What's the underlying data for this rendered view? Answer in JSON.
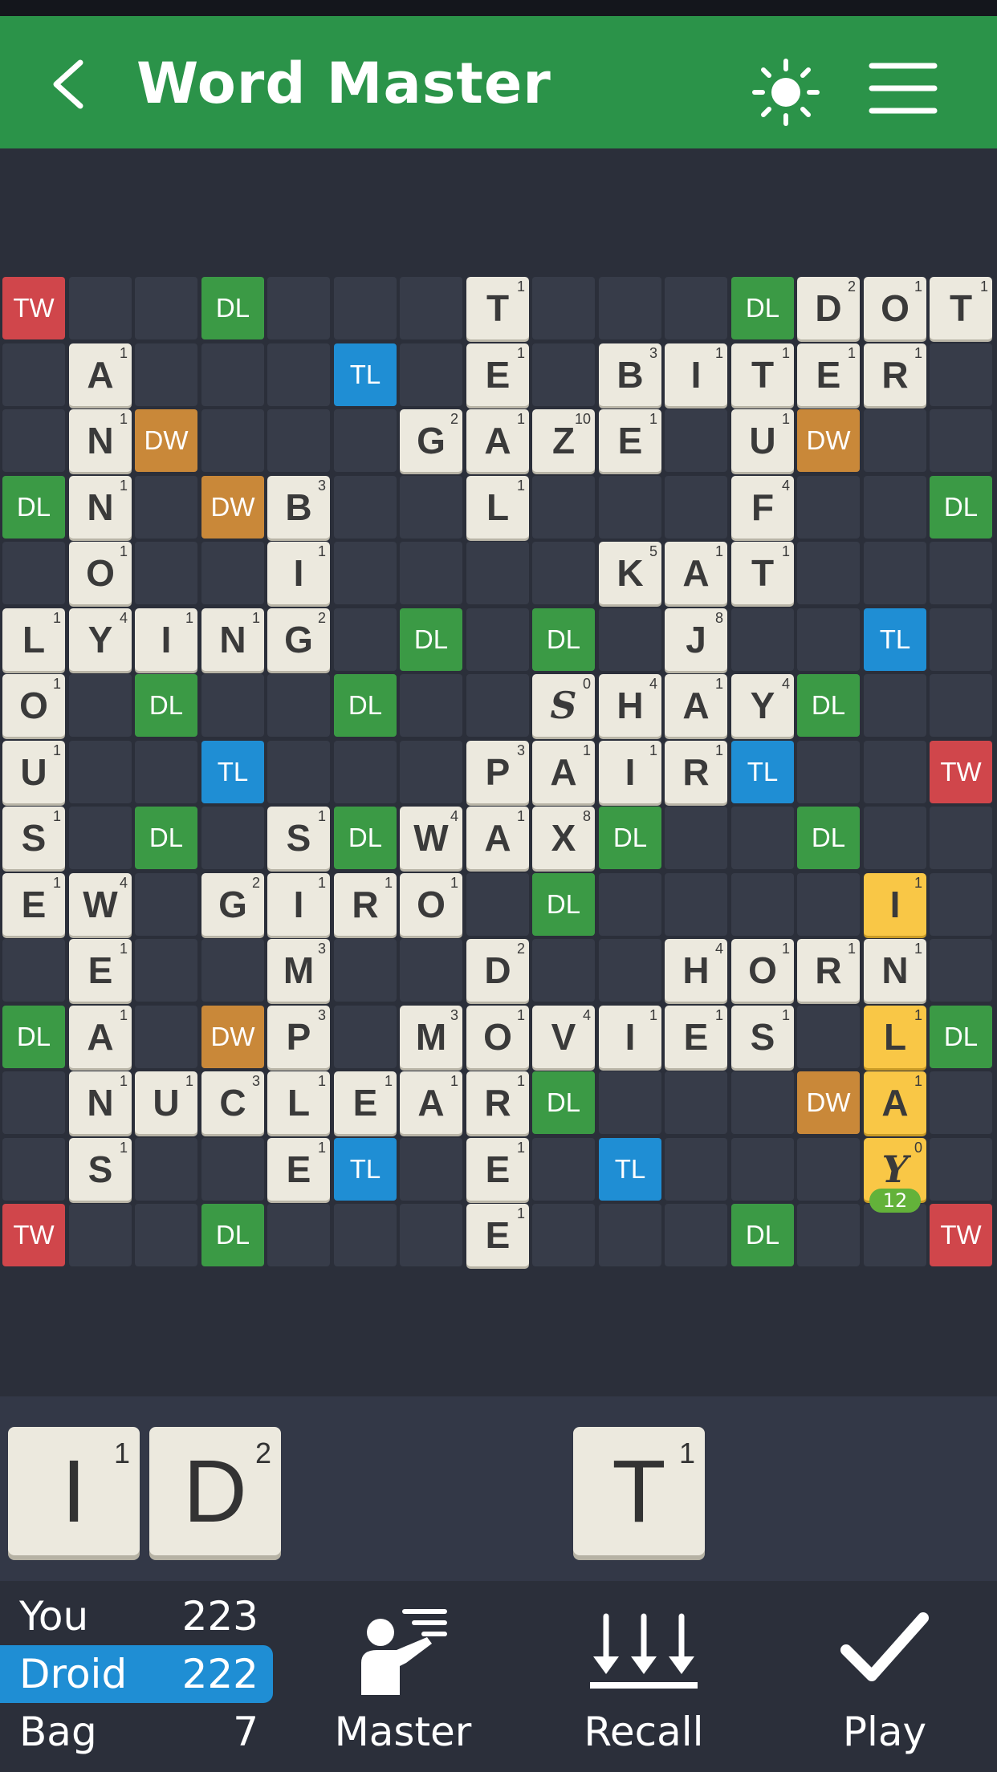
{
  "header": {
    "title": "Word Master",
    "back_icon": "chevron-left-icon",
    "theme_icon": "sun-icon",
    "menu_icon": "hamburger-menu-icon"
  },
  "colors": {
    "header": "#2b9349",
    "TW": "#d0464b",
    "DW": "#c98839",
    "TL": "#1f8ed4",
    "DL": "#3b9a45",
    "tile": "#ece9de",
    "recent_tile": "#f9c746",
    "active_score": "#1f8ed4"
  },
  "board": {
    "size": 15,
    "premiums": [
      {
        "r": 0,
        "c": 0,
        "type": "TW"
      },
      {
        "r": 0,
        "c": 3,
        "type": "DL"
      },
      {
        "r": 0,
        "c": 11,
        "type": "DL"
      },
      {
        "r": 1,
        "c": 5,
        "type": "TL"
      },
      {
        "r": 2,
        "c": 2,
        "type": "DW"
      },
      {
        "r": 2,
        "c": 12,
        "type": "DW"
      },
      {
        "r": 3,
        "c": 0,
        "type": "DL"
      },
      {
        "r": 3,
        "c": 3,
        "type": "DW"
      },
      {
        "r": 3,
        "c": 14,
        "type": "DL"
      },
      {
        "r": 5,
        "c": 6,
        "type": "DL"
      },
      {
        "r": 5,
        "c": 8,
        "type": "DL"
      },
      {
        "r": 5,
        "c": 13,
        "type": "TL"
      },
      {
        "r": 6,
        "c": 2,
        "type": "DL"
      },
      {
        "r": 6,
        "c": 5,
        "type": "DL"
      },
      {
        "r": 6,
        "c": 12,
        "type": "DL"
      },
      {
        "r": 7,
        "c": 3,
        "type": "TL"
      },
      {
        "r": 7,
        "c": 11,
        "type": "TL"
      },
      {
        "r": 7,
        "c": 14,
        "type": "TW"
      },
      {
        "r": 8,
        "c": 2,
        "type": "DL"
      },
      {
        "r": 8,
        "c": 5,
        "type": "DL"
      },
      {
        "r": 8,
        "c": 9,
        "type": "DL"
      },
      {
        "r": 8,
        "c": 12,
        "type": "DL"
      },
      {
        "r": 9,
        "c": 8,
        "type": "DL"
      },
      {
        "r": 11,
        "c": 0,
        "type": "DL"
      },
      {
        "r": 11,
        "c": 3,
        "type": "DW"
      },
      {
        "r": 11,
        "c": 14,
        "type": "DL"
      },
      {
        "r": 12,
        "c": 8,
        "type": "DL"
      },
      {
        "r": 12,
        "c": 12,
        "type": "DW"
      },
      {
        "r": 13,
        "c": 5,
        "type": "TL"
      },
      {
        "r": 13,
        "c": 9,
        "type": "TL"
      },
      {
        "r": 14,
        "c": 0,
        "type": "TW"
      },
      {
        "r": 14,
        "c": 3,
        "type": "DL"
      },
      {
        "r": 14,
        "c": 11,
        "type": "DL"
      },
      {
        "r": 14,
        "c": 14,
        "type": "TW"
      }
    ],
    "tiles": [
      {
        "r": 0,
        "c": 7,
        "l": "T",
        "v": "1"
      },
      {
        "r": 0,
        "c": 12,
        "l": "D",
        "v": "2"
      },
      {
        "r": 0,
        "c": 13,
        "l": "O",
        "v": "1"
      },
      {
        "r": 0,
        "c": 14,
        "l": "T",
        "v": "1"
      },
      {
        "r": 1,
        "c": 1,
        "l": "A",
        "v": "1"
      },
      {
        "r": 1,
        "c": 7,
        "l": "E",
        "v": "1"
      },
      {
        "r": 1,
        "c": 9,
        "l": "B",
        "v": "3"
      },
      {
        "r": 1,
        "c": 10,
        "l": "I",
        "v": "1"
      },
      {
        "r": 1,
        "c": 11,
        "l": "T",
        "v": "1"
      },
      {
        "r": 1,
        "c": 12,
        "l": "E",
        "v": "1"
      },
      {
        "r": 1,
        "c": 13,
        "l": "R",
        "v": "1"
      },
      {
        "r": 2,
        "c": 1,
        "l": "N",
        "v": "1"
      },
      {
        "r": 2,
        "c": 6,
        "l": "G",
        "v": "2"
      },
      {
        "r": 2,
        "c": 7,
        "l": "A",
        "v": "1"
      },
      {
        "r": 2,
        "c": 8,
        "l": "Z",
        "v": "10"
      },
      {
        "r": 2,
        "c": 9,
        "l": "E",
        "v": "1"
      },
      {
        "r": 2,
        "c": 11,
        "l": "U",
        "v": "1"
      },
      {
        "r": 3,
        "c": 1,
        "l": "N",
        "v": "1"
      },
      {
        "r": 3,
        "c": 4,
        "l": "B",
        "v": "3"
      },
      {
        "r": 3,
        "c": 7,
        "l": "L",
        "v": "1"
      },
      {
        "r": 3,
        "c": 11,
        "l": "F",
        "v": "4"
      },
      {
        "r": 4,
        "c": 1,
        "l": "O",
        "v": "1"
      },
      {
        "r": 4,
        "c": 4,
        "l": "I",
        "v": "1"
      },
      {
        "r": 4,
        "c": 9,
        "l": "K",
        "v": "5"
      },
      {
        "r": 4,
        "c": 10,
        "l": "A",
        "v": "1"
      },
      {
        "r": 4,
        "c": 11,
        "l": "T",
        "v": "1"
      },
      {
        "r": 5,
        "c": 0,
        "l": "L",
        "v": "1"
      },
      {
        "r": 5,
        "c": 1,
        "l": "Y",
        "v": "4"
      },
      {
        "r": 5,
        "c": 2,
        "l": "I",
        "v": "1"
      },
      {
        "r": 5,
        "c": 3,
        "l": "N",
        "v": "1"
      },
      {
        "r": 5,
        "c": 4,
        "l": "G",
        "v": "2"
      },
      {
        "r": 5,
        "c": 10,
        "l": "J",
        "v": "8"
      },
      {
        "r": 6,
        "c": 0,
        "l": "O",
        "v": "1"
      },
      {
        "r": 6,
        "c": 8,
        "l": "S",
        "v": "0",
        "blank": true
      },
      {
        "r": 6,
        "c": 9,
        "l": "H",
        "v": "4"
      },
      {
        "r": 6,
        "c": 10,
        "l": "A",
        "v": "1"
      },
      {
        "r": 6,
        "c": 11,
        "l": "Y",
        "v": "4"
      },
      {
        "r": 7,
        "c": 0,
        "l": "U",
        "v": "1"
      },
      {
        "r": 7,
        "c": 7,
        "l": "P",
        "v": "3"
      },
      {
        "r": 7,
        "c": 8,
        "l": "A",
        "v": "1"
      },
      {
        "r": 7,
        "c": 9,
        "l": "I",
        "v": "1"
      },
      {
        "r": 7,
        "c": 10,
        "l": "R",
        "v": "1"
      },
      {
        "r": 8,
        "c": 0,
        "l": "S",
        "v": "1"
      },
      {
        "r": 8,
        "c": 4,
        "l": "S",
        "v": "1"
      },
      {
        "r": 8,
        "c": 6,
        "l": "W",
        "v": "4"
      },
      {
        "r": 8,
        "c": 7,
        "l": "A",
        "v": "1"
      },
      {
        "r": 8,
        "c": 8,
        "l": "X",
        "v": "8"
      },
      {
        "r": 9,
        "c": 0,
        "l": "E",
        "v": "1"
      },
      {
        "r": 9,
        "c": 1,
        "l": "W",
        "v": "4"
      },
      {
        "r": 9,
        "c": 3,
        "l": "G",
        "v": "2"
      },
      {
        "r": 9,
        "c": 4,
        "l": "I",
        "v": "1"
      },
      {
        "r": 9,
        "c": 5,
        "l": "R",
        "v": "1"
      },
      {
        "r": 9,
        "c": 6,
        "l": "O",
        "v": "1"
      },
      {
        "r": 9,
        "c": 13,
        "l": "I",
        "v": "1",
        "recent": true
      },
      {
        "r": 10,
        "c": 1,
        "l": "E",
        "v": "1"
      },
      {
        "r": 10,
        "c": 4,
        "l": "M",
        "v": "3"
      },
      {
        "r": 10,
        "c": 7,
        "l": "D",
        "v": "2"
      },
      {
        "r": 10,
        "c": 10,
        "l": "H",
        "v": "4"
      },
      {
        "r": 10,
        "c": 11,
        "l": "O",
        "v": "1"
      },
      {
        "r": 10,
        "c": 12,
        "l": "R",
        "v": "1"
      },
      {
        "r": 10,
        "c": 13,
        "l": "N",
        "v": "1"
      },
      {
        "r": 11,
        "c": 1,
        "l": "A",
        "v": "1"
      },
      {
        "r": 11,
        "c": 4,
        "l": "P",
        "v": "3"
      },
      {
        "r": 11,
        "c": 6,
        "l": "M",
        "v": "3"
      },
      {
        "r": 11,
        "c": 7,
        "l": "O",
        "v": "1"
      },
      {
        "r": 11,
        "c": 8,
        "l": "V",
        "v": "4"
      },
      {
        "r": 11,
        "c": 9,
        "l": "I",
        "v": "1"
      },
      {
        "r": 11,
        "c": 10,
        "l": "E",
        "v": "1"
      },
      {
        "r": 11,
        "c": 11,
        "l": "S",
        "v": "1"
      },
      {
        "r": 11,
        "c": 13,
        "l": "L",
        "v": "1",
        "recent": true
      },
      {
        "r": 12,
        "c": 1,
        "l": "N",
        "v": "1"
      },
      {
        "r": 12,
        "c": 2,
        "l": "U",
        "v": "1"
      },
      {
        "r": 12,
        "c": 3,
        "l": "C",
        "v": "3"
      },
      {
        "r": 12,
        "c": 4,
        "l": "L",
        "v": "1"
      },
      {
        "r": 12,
        "c": 5,
        "l": "E",
        "v": "1"
      },
      {
        "r": 12,
        "c": 6,
        "l": "A",
        "v": "1"
      },
      {
        "r": 12,
        "c": 7,
        "l": "R",
        "v": "1"
      },
      {
        "r": 12,
        "c": 13,
        "l": "A",
        "v": "1",
        "recent": true
      },
      {
        "r": 13,
        "c": 1,
        "l": "S",
        "v": "1"
      },
      {
        "r": 13,
        "c": 4,
        "l": "E",
        "v": "1"
      },
      {
        "r": 13,
        "c": 7,
        "l": "E",
        "v": "1"
      },
      {
        "r": 13,
        "c": 13,
        "l": "Y",
        "v": "0",
        "blank": true,
        "recent": true
      },
      {
        "r": 14,
        "c": 7,
        "l": "E",
        "v": "1"
      }
    ],
    "last_move_score": {
      "r": 13,
      "c": 13,
      "value": "12"
    }
  },
  "rack": [
    {
      "slot": 0,
      "l": "I",
      "v": "1"
    },
    {
      "slot": 1,
      "l": "D",
      "v": "2"
    },
    {
      "slot": 4,
      "l": "T",
      "v": "1"
    }
  ],
  "scores": [
    {
      "name": "You",
      "points": "223",
      "active": false
    },
    {
      "name": "Droid",
      "points": "222",
      "active": true
    },
    {
      "name": "Bag",
      "points": "7",
      "active": false
    }
  ],
  "actions": {
    "master": {
      "label": "Master",
      "icon": "teacher-icon"
    },
    "recall": {
      "label": "Recall",
      "icon": "recall-arrows-icon"
    },
    "play": {
      "label": "Play",
      "icon": "checkmark-icon"
    }
  }
}
